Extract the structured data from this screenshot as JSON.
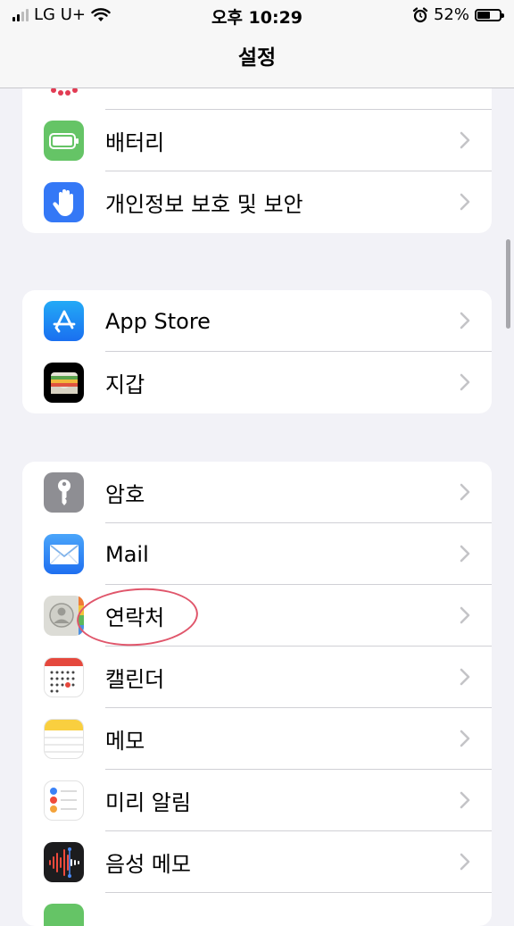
{
  "status_bar": {
    "carrier": "LG U+",
    "time": "오후 10:29",
    "battery_percent": "52%",
    "battery_level": 0.52,
    "icons": [
      "signal-bars-icon",
      "wifi-icon",
      "alarm-icon",
      "battery-icon"
    ]
  },
  "nav": {
    "title": "설정"
  },
  "group1": {
    "items": [
      {
        "label": "배터리",
        "icon": "battery-icon",
        "color": "#65c466"
      },
      {
        "label": "개인정보 보호 및 보안",
        "icon": "hand-icon",
        "color": "#3478f6"
      }
    ]
  },
  "group2": {
    "items": [
      {
        "label": "App Store",
        "icon": "app-store-icon",
        "color": "#1e8ef0"
      },
      {
        "label": "지갑",
        "icon": "wallet-icon",
        "color": "#000000"
      }
    ]
  },
  "group3": {
    "items": [
      {
        "label": "암호",
        "icon": "key-icon",
        "color": "#8e8e93"
      },
      {
        "label": "Mail",
        "icon": "mail-icon",
        "color": "#2f88f6"
      },
      {
        "label": "연락처",
        "icon": "contacts-icon",
        "color": "#d8d8d3"
      },
      {
        "label": "캘린더",
        "icon": "calendar-icon",
        "color": "#ffffff"
      },
      {
        "label": "메모",
        "icon": "notes-icon",
        "color": "#ffffff"
      },
      {
        "label": "미리 알림",
        "icon": "reminders-icon",
        "color": "#ffffff"
      },
      {
        "label": "음성 메모",
        "icon": "voice-memos-icon",
        "color": "#1c1c1e"
      },
      {
        "label": "",
        "icon": "phone-icon",
        "color": "#65c466"
      }
    ]
  },
  "accent_colors": {
    "annotation_circle": "#e0566b",
    "chevron": "#c4c4c7"
  }
}
